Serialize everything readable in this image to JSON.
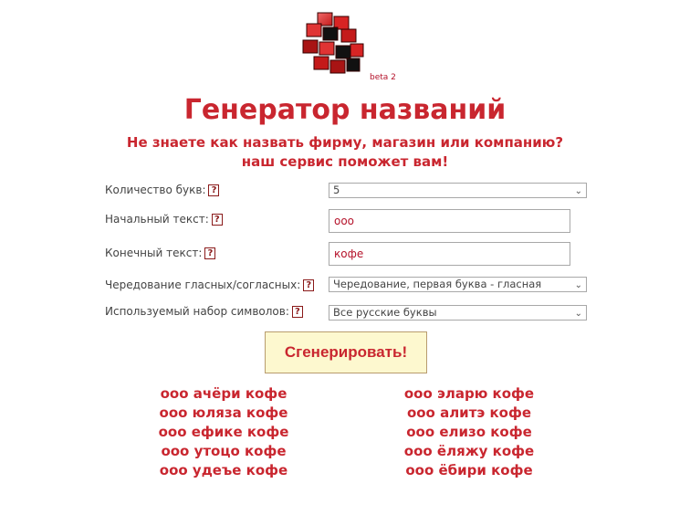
{
  "header": {
    "beta": "beta 2",
    "title": "Генератор названий",
    "subtitle_line1": "Не знаете как назвать фирму, магазин или компанию?",
    "subtitle_line2": "наш сервис поможет вам!"
  },
  "form": {
    "help_glyph": "?",
    "letters_label": "Количество букв:",
    "letters_value": "5",
    "start_label": "Начальный текст:",
    "start_value": "ооо",
    "end_label": "Конечный текст:",
    "end_value": "кофе",
    "alternation_label": "Чередование гласных/согласных:",
    "alternation_value": "Чередование, первая буква - гласная",
    "charset_label": "Используемый набор символов:",
    "charset_value": "Все русские буквы",
    "generate_button": "Сгенерировать!"
  },
  "results": {
    "left": [
      "ооо ачёри кофе",
      "ооо юляза кофе",
      "ооо ефике кофе",
      "ооо утоцо кофе",
      "ооо удеъе кофе"
    ],
    "right": [
      "ооо эларю кофе",
      "ооо алитэ кофе",
      "ооо елизо кофе",
      "ооо ёляжу кофе",
      "ооо ёбири кофе"
    ]
  },
  "colors": {
    "accent": "#c9262f",
    "button_bg": "#fdf8cf"
  }
}
